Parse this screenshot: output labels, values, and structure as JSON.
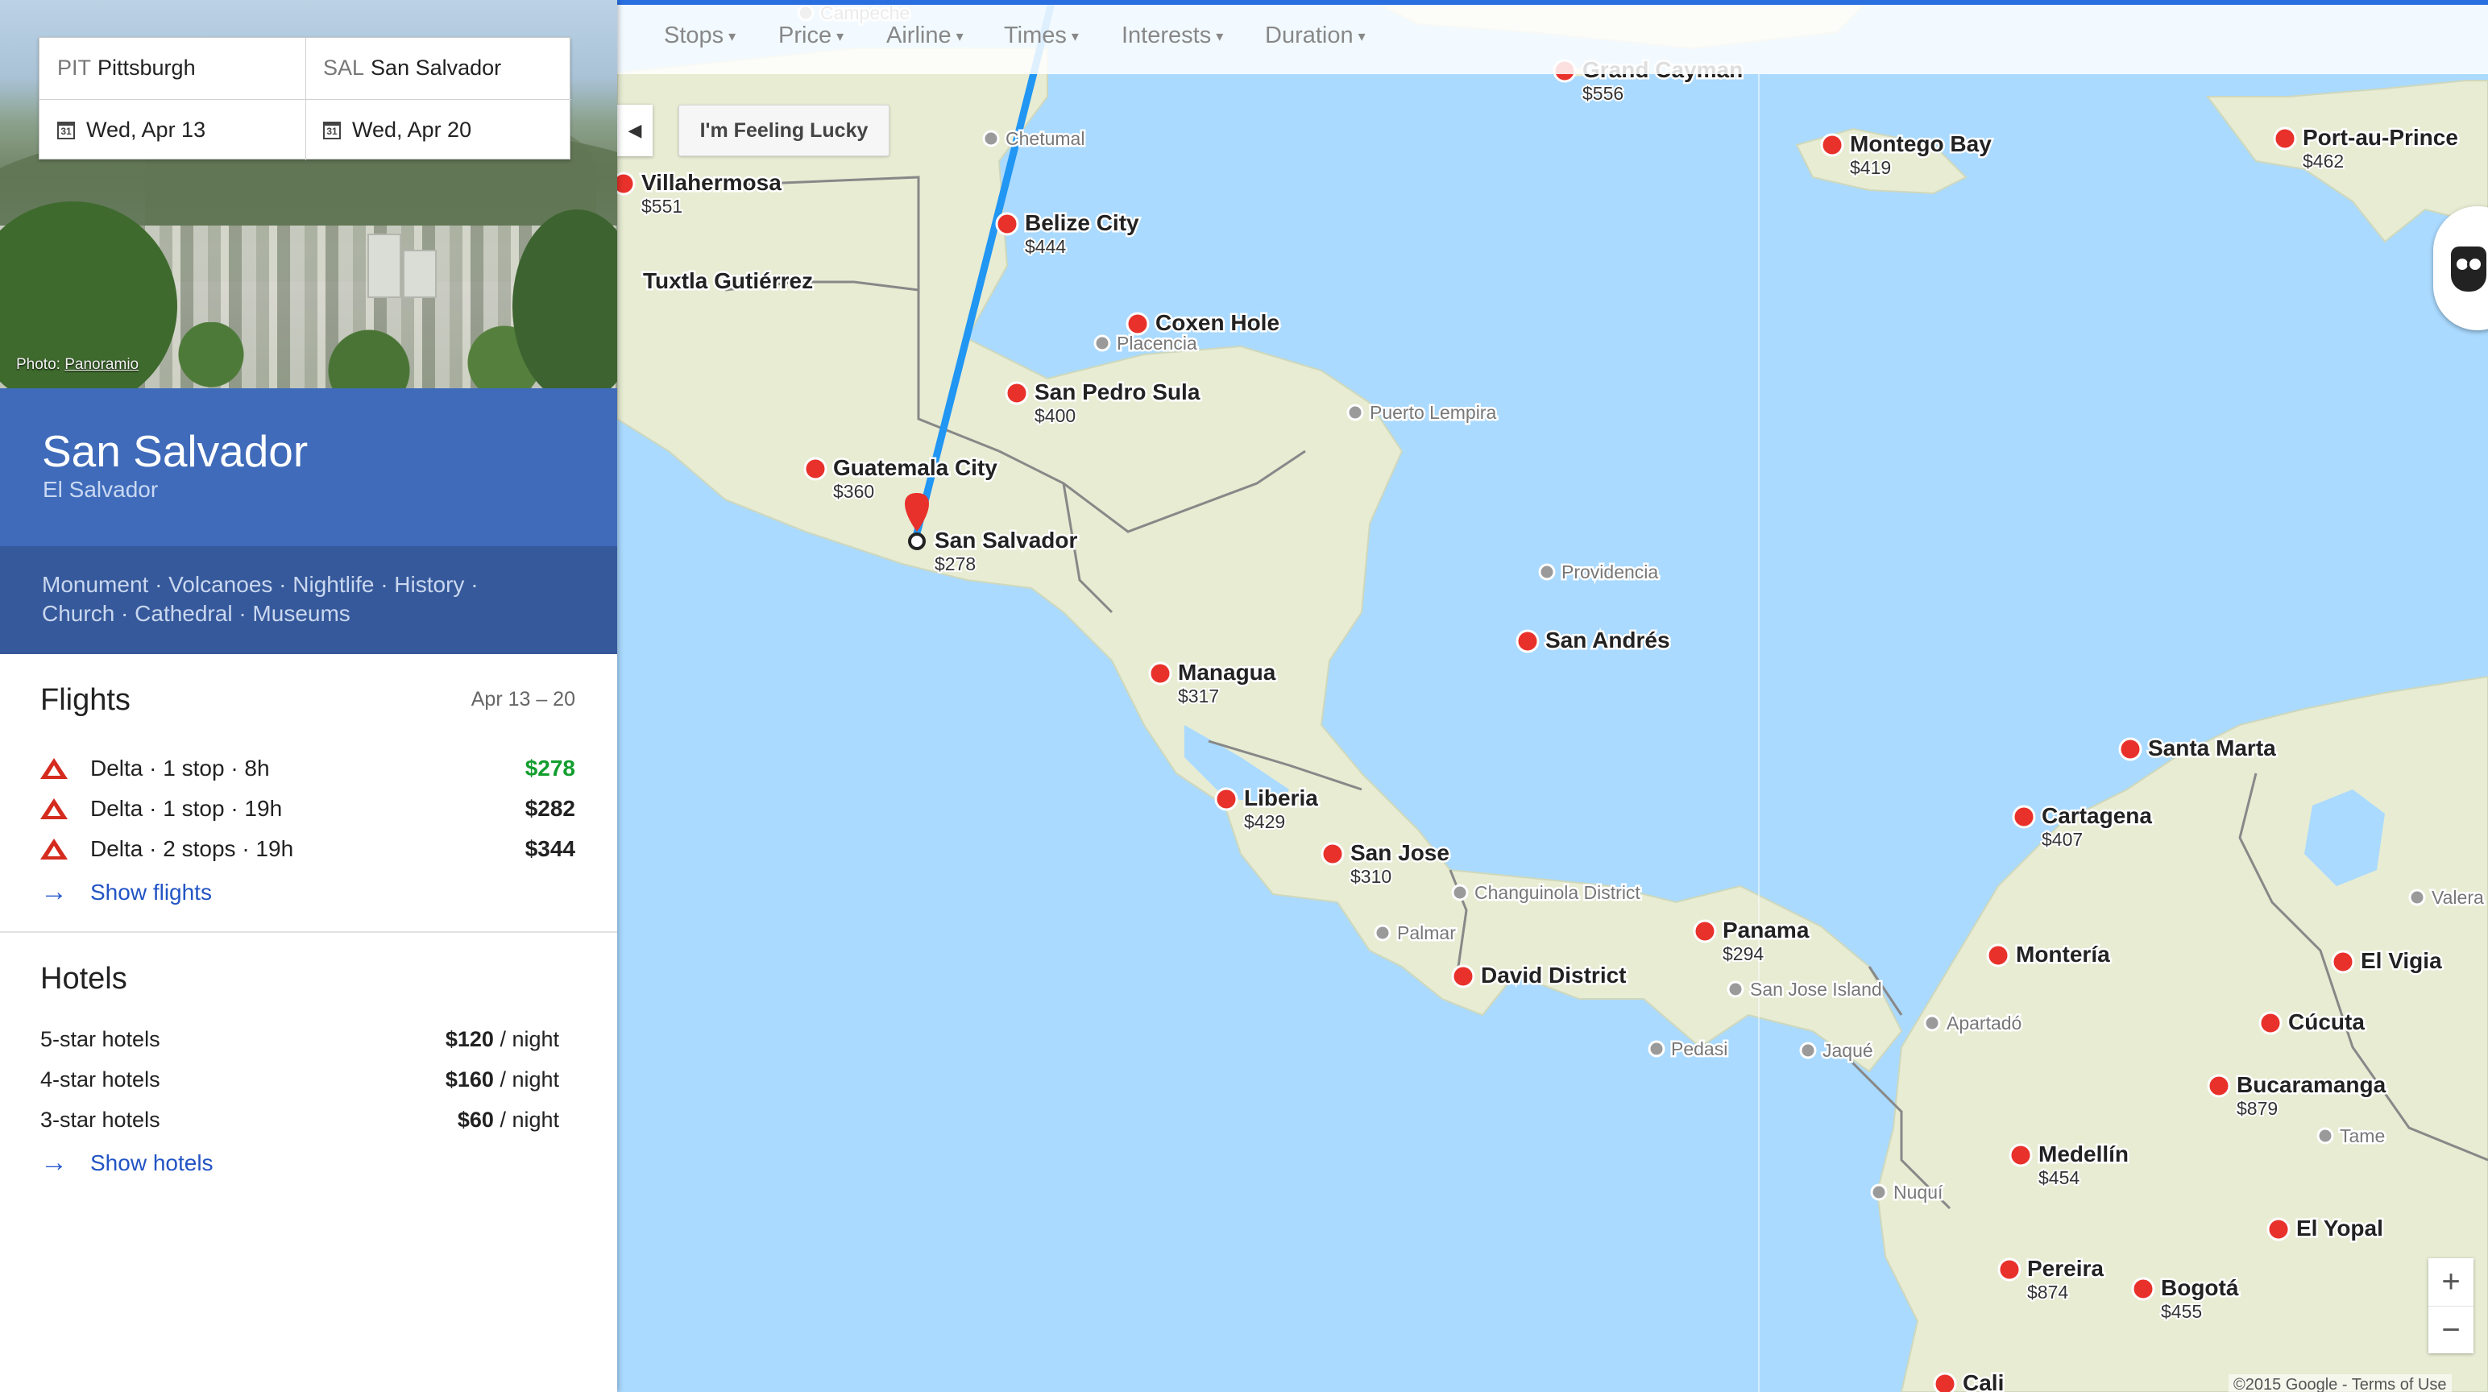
{
  "search": {
    "origin_code": "PIT",
    "origin_city": "Pittsburgh",
    "dest_code": "SAL",
    "dest_city": "San Salvador",
    "depart_date": "Wed, Apr 13",
    "return_date": "Wed, Apr 20",
    "calendar_icon_text": "31"
  },
  "hero": {
    "photo_credit_prefix": "Photo: ",
    "photo_credit_source": "Panoramio"
  },
  "destination": {
    "name": "San Salvador",
    "country": "El Salvador",
    "interests_line1": "Monument · Volcanoes · Nightlife · History ·",
    "interests_line2": "Church · Cathedral · Museums"
  },
  "flights": {
    "title": "Flights",
    "dates": "Apr 13 – 20",
    "rows": [
      {
        "airline": "Delta",
        "details": "1 stop · 8h",
        "price": "$278"
      },
      {
        "airline": "Delta",
        "details": "1 stop · 19h",
        "price": "$282"
      },
      {
        "airline": "Delta",
        "details": "2 stops · 19h",
        "price": "$344"
      }
    ],
    "show_label": "Show flights"
  },
  "hotels": {
    "title": "Hotels",
    "rows": [
      {
        "label": "5-star hotels",
        "price": "$120",
        "unit": " / night"
      },
      {
        "label": "4-star hotels",
        "price": "$160",
        "unit": " / night"
      },
      {
        "label": "3-star hotels",
        "price": "$60",
        "unit": " / night"
      }
    ],
    "show_label": "Show hotels"
  },
  "filters": [
    "Stops",
    "Price",
    "Airline",
    "Times",
    "Interests",
    "Duration"
  ],
  "lucky_label": "I'm Feeling Lucky",
  "zoom": {
    "in": "+",
    "out": "−"
  },
  "attribution": "©2015 Google -   Terms of Use",
  "colors": {
    "header_blue": "#3f6bba",
    "tags_blue": "#36599b",
    "link_blue": "#2354c4",
    "best_price_green": "#129e2e",
    "route_blue": "#2196f3",
    "pin_red": "#e8312a",
    "water": "#aadaff",
    "land": "#e8ecd6"
  },
  "map": {
    "cities": [
      {
        "name": "Villahermosa",
        "price": "$551"
      },
      {
        "name": "Tuxtla Gutiérrez",
        "price": ""
      },
      {
        "name": "Chetumal",
        "price": ""
      },
      {
        "name": "Belize City",
        "price": "$444"
      },
      {
        "name": "Placencia",
        "price": ""
      },
      {
        "name": "Coxen Hole",
        "price": ""
      },
      {
        "name": "San Pedro Sula",
        "price": "$400"
      },
      {
        "name": "Puerto Lempira",
        "price": ""
      },
      {
        "name": "Guatemala City",
        "price": "$360"
      },
      {
        "name": "San Salvador",
        "price": "$278"
      },
      {
        "name": "Managua",
        "price": "$317"
      },
      {
        "name": "Providencia",
        "price": ""
      },
      {
        "name": "San Andrés",
        "price": ""
      },
      {
        "name": "Liberia",
        "price": "$429"
      },
      {
        "name": "San Jose",
        "price": "$310"
      },
      {
        "name": "Changuinola District",
        "price": ""
      },
      {
        "name": "Palmar",
        "price": ""
      },
      {
        "name": "David District",
        "price": ""
      },
      {
        "name": "Panama",
        "price": "$294"
      },
      {
        "name": "San Jose Island",
        "price": ""
      },
      {
        "name": "Pedasi",
        "price": ""
      },
      {
        "name": "Jaqué",
        "price": ""
      },
      {
        "name": "Grand Cayman",
        "price": "$556"
      },
      {
        "name": "Montego Bay",
        "price": "$419"
      },
      {
        "name": "Port-au-Prince",
        "price": "$462"
      },
      {
        "name": "Santa Marta",
        "price": ""
      },
      {
        "name": "Cartagena",
        "price": "$407"
      },
      {
        "name": "Montería",
        "price": ""
      },
      {
        "name": "Apartadó",
        "price": ""
      },
      {
        "name": "El Vigia",
        "price": ""
      },
      {
        "name": "Cúcuta",
        "price": ""
      },
      {
        "name": "Bucaramanga",
        "price": "$879"
      },
      {
        "name": "Tame",
        "price": ""
      },
      {
        "name": "Medellín",
        "price": "$454"
      },
      {
        "name": "Nuquí",
        "price": ""
      },
      {
        "name": "El Yopal",
        "price": ""
      },
      {
        "name": "Pereira",
        "price": "$874"
      },
      {
        "name": "Bogotá",
        "price": "$455"
      },
      {
        "name": "Cali",
        "price": ""
      },
      {
        "name": "Campeche",
        "price": ""
      },
      {
        "name": "Valera",
        "price": ""
      }
    ]
  }
}
